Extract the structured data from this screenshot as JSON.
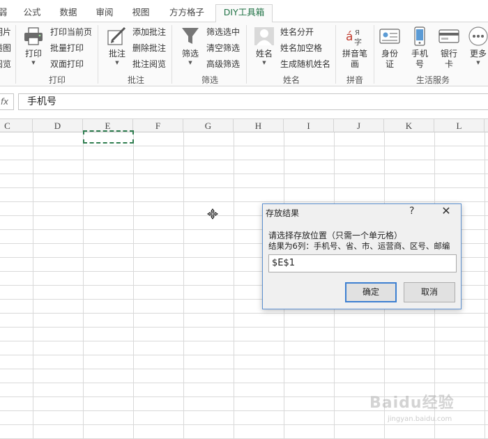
{
  "tabs": [
    {
      "label": "弱",
      "active": false
    },
    {
      "label": "公式",
      "active": false
    },
    {
      "label": "数据",
      "active": false
    },
    {
      "label": "审阅",
      "active": false
    },
    {
      "label": "视图",
      "active": false
    },
    {
      "label": "方方格子",
      "active": false
    },
    {
      "label": "DIY工具箱",
      "active": true
    }
  ],
  "ribbon": {
    "partial_group": {
      "items": [
        "明片",
        "透图",
        "阅览"
      ]
    },
    "print_group": {
      "label": "打印",
      "big_button": "打印",
      "items": [
        "打印当前页",
        "批量打印",
        "双面打印"
      ]
    },
    "comment_group": {
      "label": "批注",
      "big_button": "批注",
      "items": [
        "添加批注",
        "删除批注",
        "批注阅览"
      ]
    },
    "filter_group": {
      "label": "筛选",
      "big_button": "筛选",
      "items": [
        "筛选选中",
        "清空筛选",
        "高级筛选"
      ]
    },
    "name_group": {
      "label": "姓名",
      "big_button": "姓名",
      "items": [
        "姓名分开",
        "姓名加空格",
        "生成随机姓名"
      ]
    },
    "pinyin_group": {
      "label": "拼音",
      "big_button_line1": "拼音笔",
      "big_button_line2": "画"
    },
    "life_group": {
      "label": "生活服务",
      "buttons": [
        {
          "line1": "身份",
          "line2": "证"
        },
        {
          "line1": "手机",
          "line2": "号"
        },
        {
          "line1": "银行",
          "line2": "卡"
        },
        {
          "line1": "更多",
          "line2": ""
        }
      ]
    }
  },
  "formula_bar": {
    "fx_label": "fx",
    "value": "手机号"
  },
  "columns": [
    "C",
    "D",
    "E",
    "F",
    "G",
    "H",
    "I",
    "J",
    "K",
    "L"
  ],
  "dialog": {
    "title": "存放结果",
    "help": "?",
    "close": "✕",
    "instruction": "请选择存放位置（只需一个单元格）",
    "result_note": "结果为6列：手机号、省、市、运营商、区号、邮编",
    "input_value": "$E$1",
    "ok_label": "确定",
    "cancel_label": "取消"
  },
  "watermark": {
    "brand": "Baidu经验",
    "url": "jingyan.baidu.com"
  }
}
